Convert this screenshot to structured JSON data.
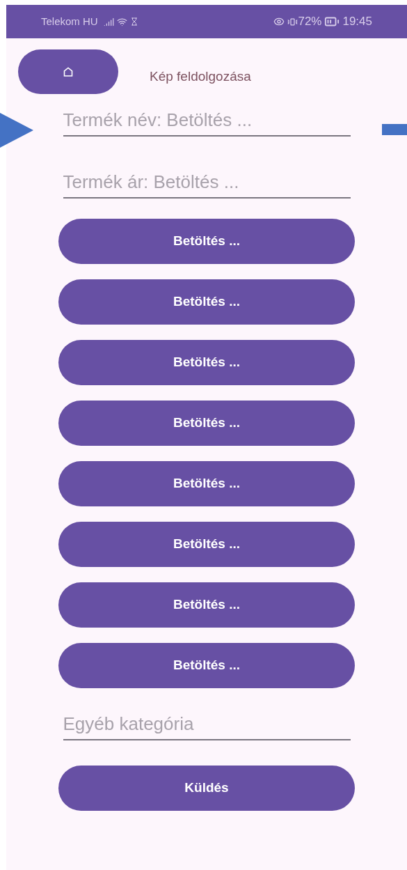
{
  "status_bar": {
    "carrier": "Telekom HU",
    "battery": "72%",
    "time": "19:45"
  },
  "header": {
    "title": "Kép feldolgozása"
  },
  "fields": [
    {
      "placeholder": "Termék név: Betöltés ..."
    },
    {
      "placeholder": "Termék ár: Betöltés ..."
    }
  ],
  "buttons": [
    "Betöltés ...",
    "Betöltés ...",
    "Betöltés ...",
    "Betöltés ...",
    "Betöltés ...",
    "Betöltés ...",
    "Betöltés ...",
    "Betöltés ..."
  ],
  "other_field": {
    "placeholder": "Egyéb kategória"
  },
  "submit": {
    "label": "Küldés"
  }
}
